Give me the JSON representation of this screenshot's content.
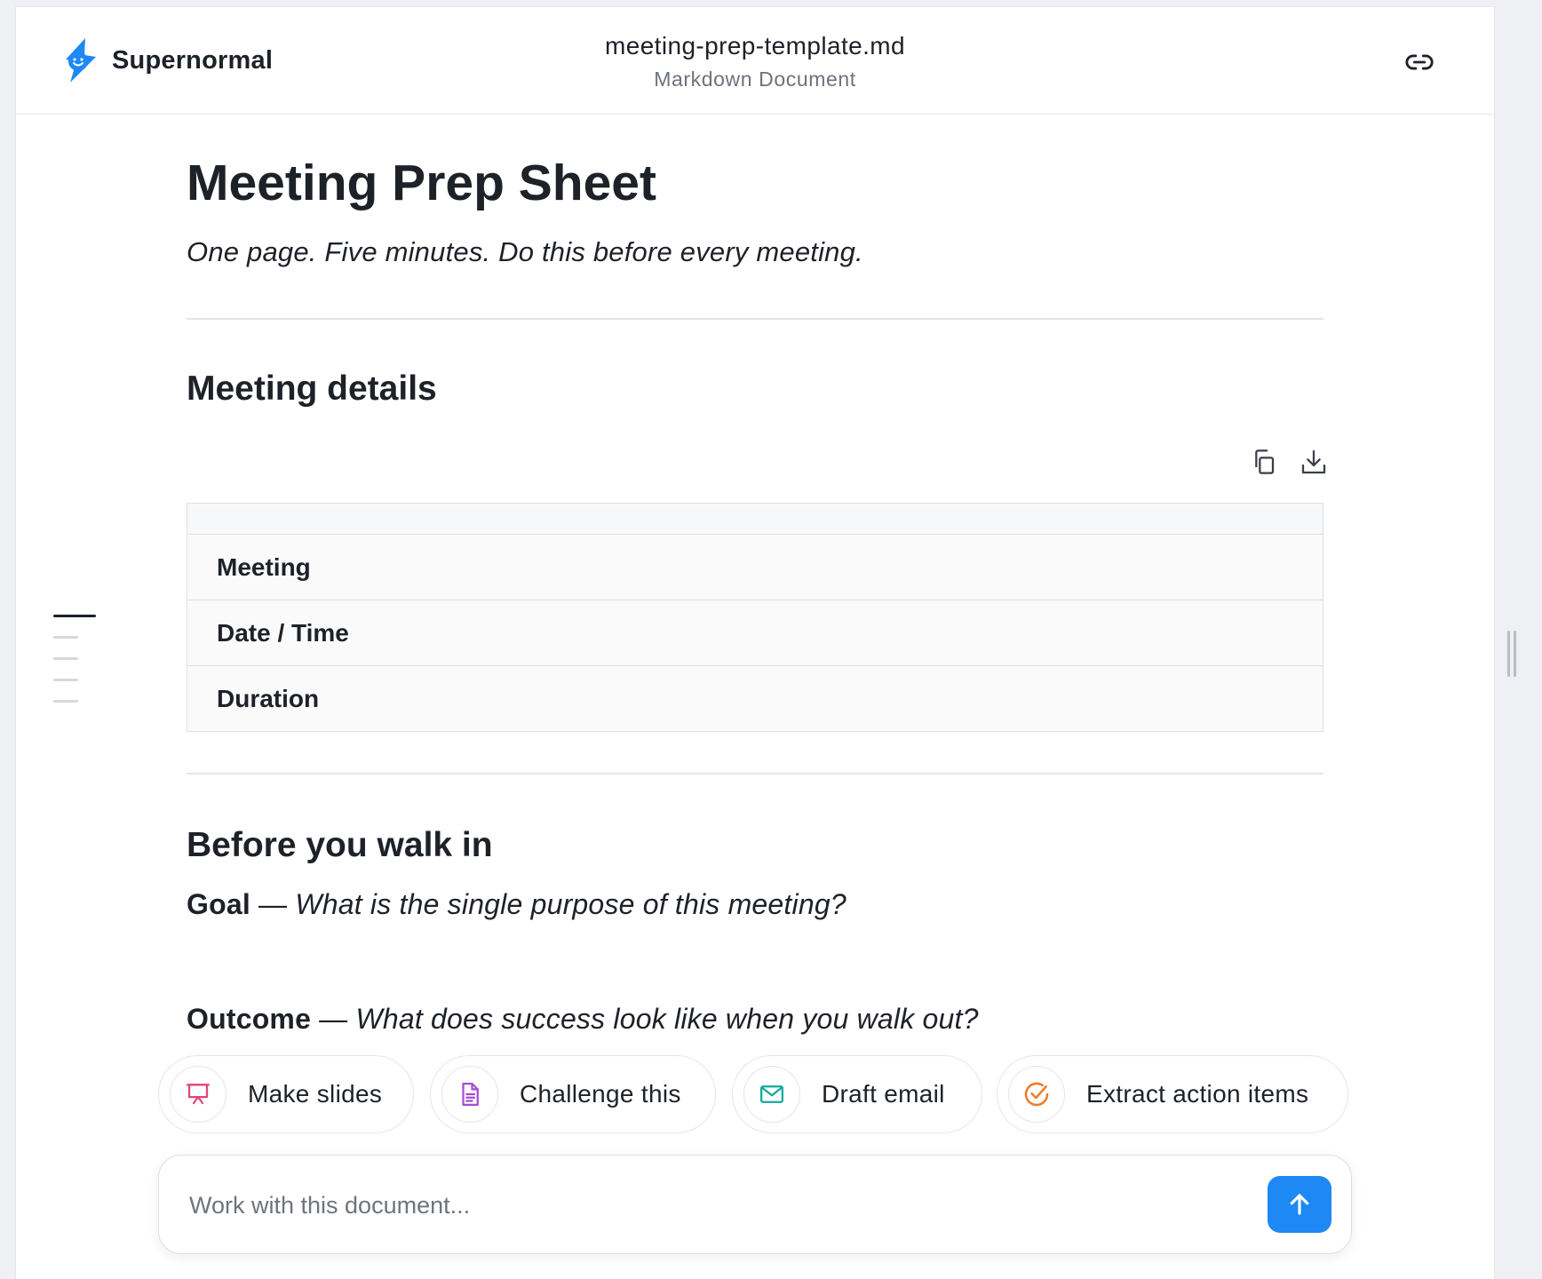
{
  "header": {
    "brand": "Supernormal",
    "file_name": "meeting-prep-template.md",
    "file_type": "Markdown Document",
    "link_icon": "link-icon"
  },
  "document": {
    "title": "Meeting Prep Sheet",
    "lede": "One page. Five minutes. Do this before every meeting.",
    "section_details": {
      "heading": "Meeting details",
      "table_header": [
        ""
      ],
      "rows": [
        "Meeting",
        "Date / Time",
        "Duration"
      ]
    },
    "section_before": {
      "heading": "Before you walk in",
      "goal": {
        "label": "Goal",
        "dash": " — ",
        "prompt": "What is the single purpose of this meeting?"
      },
      "outcome": {
        "label": "Outcome",
        "dash": " — ",
        "prompt": "What does success look like when you walk out?"
      }
    }
  },
  "table_tools": {
    "copy_icon": "copy-icon",
    "download_icon": "download-icon"
  },
  "actions": [
    {
      "label": "Make slides",
      "icon": "presentation-icon",
      "color": "#e0457b"
    },
    {
      "label": "Challenge this",
      "icon": "document-icon",
      "color": "#a64bd6"
    },
    {
      "label": "Draft email",
      "icon": "mail-icon",
      "color": "#14a99a"
    },
    {
      "label": "Extract action items",
      "icon": "check-circle-icon",
      "color": "#f07a2a"
    }
  ],
  "composer": {
    "placeholder": "Work with this document...",
    "send_icon": "arrow-up-icon",
    "send_color": "#1e88f5"
  },
  "colors": {
    "brand_blue": "#1e88f5",
    "text": "#1d2128",
    "muted": "#6d737c",
    "border": "#e3e6eb"
  }
}
